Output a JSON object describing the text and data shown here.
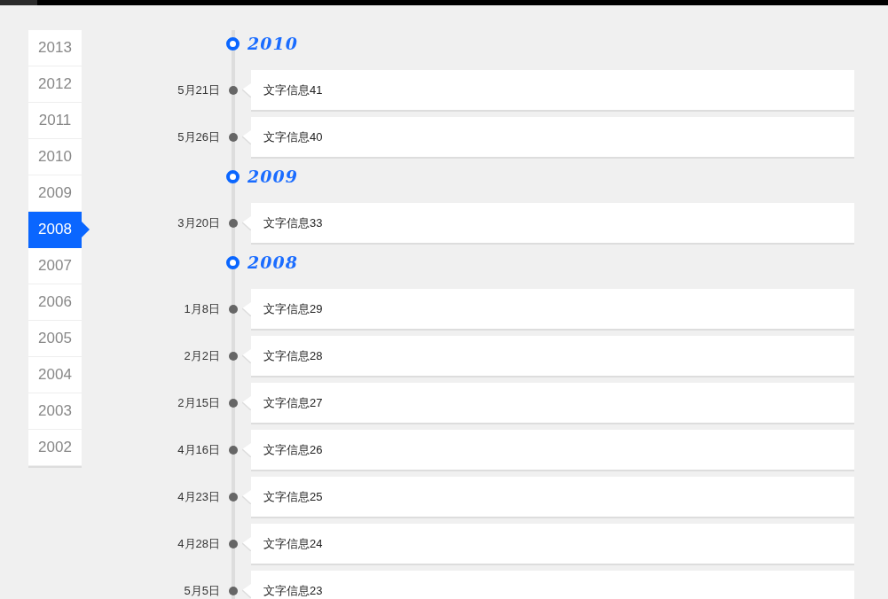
{
  "year_nav": {
    "items": [
      {
        "label": "2013",
        "selected": false
      },
      {
        "label": "2012",
        "selected": false
      },
      {
        "label": "2011",
        "selected": false
      },
      {
        "label": "2010",
        "selected": false
      },
      {
        "label": "2009",
        "selected": false
      },
      {
        "label": "2008",
        "selected": true
      },
      {
        "label": "2007",
        "selected": false
      },
      {
        "label": "2006",
        "selected": false
      },
      {
        "label": "2005",
        "selected": false
      },
      {
        "label": "2004",
        "selected": false
      },
      {
        "label": "2003",
        "selected": false
      },
      {
        "label": "2002",
        "selected": false
      }
    ]
  },
  "timeline": {
    "sections": [
      {
        "year": "2010",
        "events": [
          {
            "date": "5月21日",
            "text": "文字信息41"
          },
          {
            "date": "5月26日",
            "text": "文字信息40"
          }
        ]
      },
      {
        "year": "2009",
        "events": [
          {
            "date": "3月20日",
            "text": "文字信息33"
          }
        ]
      },
      {
        "year": "2008",
        "events": [
          {
            "date": "1月8日",
            "text": "文字信息29"
          },
          {
            "date": "2月2日",
            "text": "文字信息28"
          },
          {
            "date": "2月15日",
            "text": "文字信息27"
          },
          {
            "date": "4月16日",
            "text": "文字信息26"
          },
          {
            "date": "4月23日",
            "text": "文字信息25"
          },
          {
            "date": "4月28日",
            "text": "文字信息24"
          },
          {
            "date": "5月5日",
            "text": "文字信息23"
          }
        ]
      }
    ]
  }
}
